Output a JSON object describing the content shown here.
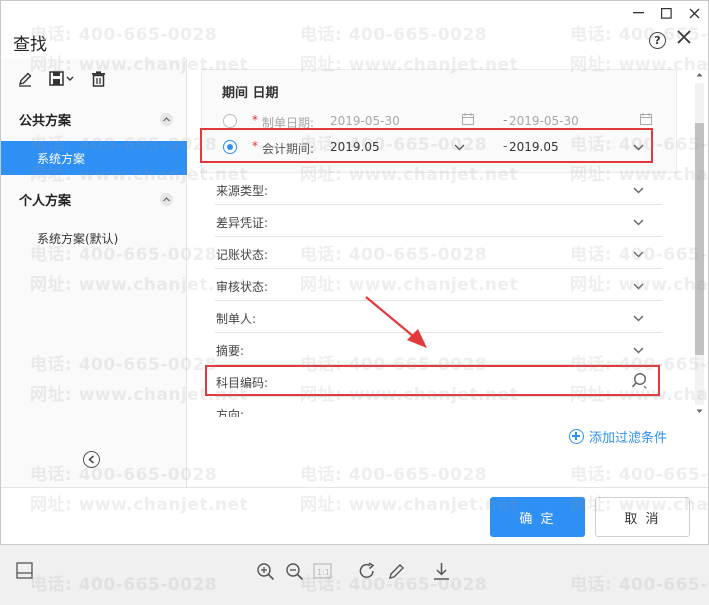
{
  "window": {
    "title": "查找",
    "controls": [
      "—",
      "☐",
      "✕"
    ]
  },
  "left": {
    "toolbar_icons": [
      "edit-icon",
      "save-icon",
      "delete-icon"
    ],
    "public_section": "公共方案",
    "public_items": [
      "系统方案"
    ],
    "personal_section": "个人方案",
    "personal_items": [
      "系统方案(默认)"
    ]
  },
  "date_section": {
    "title": "期间 日期",
    "row1": {
      "label": "制单日期:",
      "from": "2019-05-30",
      "dash": "-",
      "to": "2019-05-30"
    },
    "row2": {
      "label": "会计期间:",
      "from": "2019.05",
      "dash": "-",
      "to": "2019.05"
    },
    "required_mark": "*"
  },
  "filters": [
    {
      "label": "来源类型:"
    },
    {
      "label": "差异凭证:"
    },
    {
      "label": "记账状态:"
    },
    {
      "label": "审核状态:"
    },
    {
      "label": "制单人:"
    },
    {
      "label": "摘要:"
    },
    {
      "label": "科目编码:"
    },
    {
      "label": "方向:"
    }
  ],
  "add_filter": "添加过滤条件",
  "buttons": {
    "ok": "确 定",
    "cancel": "取 消"
  },
  "watermark": {
    "phone": "电话: 400-665-0028",
    "site": "网址: www.chanjet.net"
  },
  "colors": {
    "accent": "#2e8ff4",
    "highlight": "#e4393c",
    "arrow": "#e4393c"
  }
}
